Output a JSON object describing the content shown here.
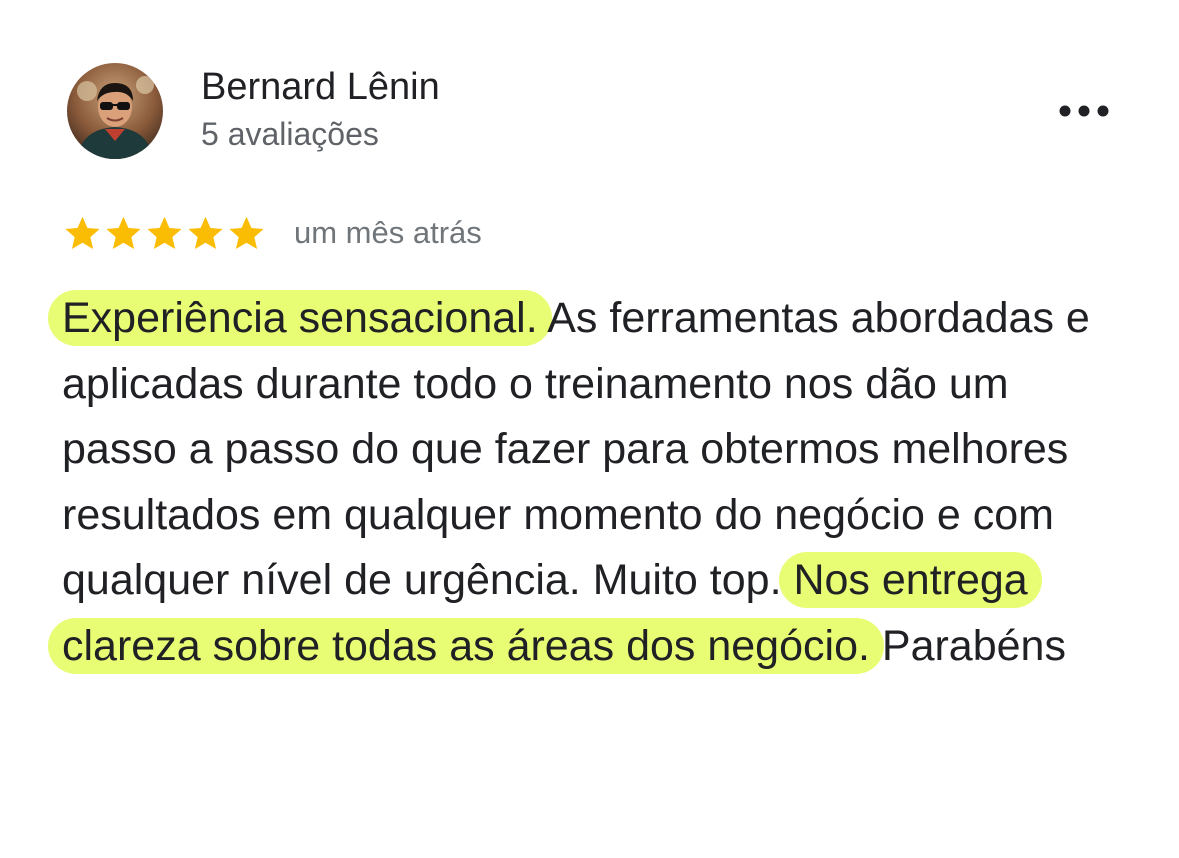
{
  "reviewer": {
    "name": "Bernard Lênin",
    "reviews_count": "5 avaliações",
    "avatar_icon": "person-avatar-icon"
  },
  "menu": {
    "icon": "more-horizontal-icon"
  },
  "rating": {
    "stars": 5,
    "max_stars": 5,
    "star_color": "#fbbc04",
    "time": "um mês atrás"
  },
  "review": {
    "segments": [
      {
        "text": "Experiência sensacional.",
        "highlighted": true
      },
      {
        "text": " As ferramentas abordadas e aplicadas durante todo o treinamento nos dão um passo a passo do que fazer para obtermos melhores resultados em qualquer momento do negócio e com qualquer nível de urgência. Muito top. ",
        "highlighted": false
      },
      {
        "text": "Nos entrega clareza sobre todas as áreas dos negócio.",
        "highlighted": true
      },
      {
        "text": " Parabéns",
        "highlighted": false
      }
    ],
    "highlight_color": "#e9fd74",
    "text_color": "#202124"
  }
}
